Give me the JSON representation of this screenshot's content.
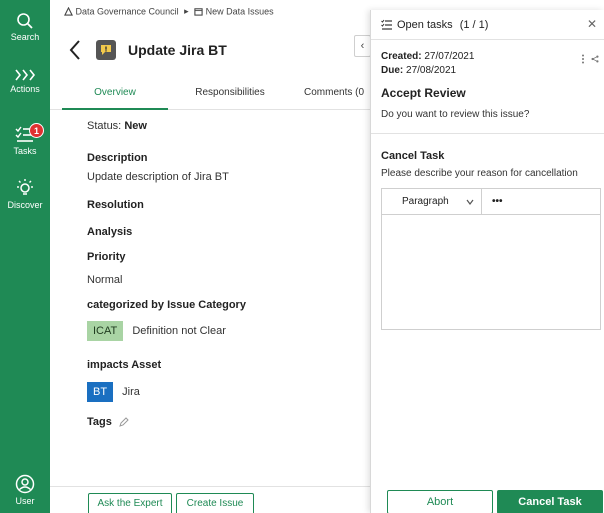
{
  "rail": {
    "search_label": "Search",
    "actions_label": "Actions",
    "tasks_label": "Tasks",
    "tasks_badge": "1",
    "discover_label": "Discover",
    "user_label": "User",
    "color": "#1f8a55"
  },
  "breadcrumb": {
    "community": "Data Governance Council",
    "separator": "▸",
    "domain": "New Data Issues"
  },
  "asset": {
    "title": "Update Jira BT",
    "collapse_glyph": "‹"
  },
  "tabs": [
    {
      "label": "Overview",
      "active": true
    },
    {
      "label": "Responsibilities",
      "active": false
    },
    {
      "label": "Comments (0",
      "active": false
    }
  ],
  "overview": {
    "status_label": "Status:",
    "status_value": "New",
    "description_label": "Description",
    "description_value": "Update description of Jira BT",
    "resolution_label": "Resolution",
    "analysis_label": "Analysis",
    "priority_label": "Priority",
    "priority_value": "Normal",
    "category_label": "categorized by Issue Category",
    "category_chip": "ICAT",
    "category_value": "Definition not Clear",
    "impacts_label": "impacts Asset",
    "impacts_chip": "BT",
    "impacts_value": "Jira",
    "tags_label": "Tags"
  },
  "footer": {
    "ask_expert": "Ask the Expert",
    "create_issue": "Create Issue"
  },
  "tasks_pane": {
    "title": "Open tasks",
    "count": "(1 / 1)",
    "created_label": "Created:",
    "created_value": "27/07/2021",
    "due_label": "Due:",
    "due_value": "27/08/2021",
    "task_name": "Accept Review",
    "task_question": "Do you want to review this issue?",
    "cancel_heading": "Cancel Task",
    "cancel_prompt": "Please describe your reason for cancellation",
    "editor_format": "Paragraph",
    "editor_more": "•••",
    "abort_label": "Abort",
    "cancel_label": "Cancel Task"
  }
}
